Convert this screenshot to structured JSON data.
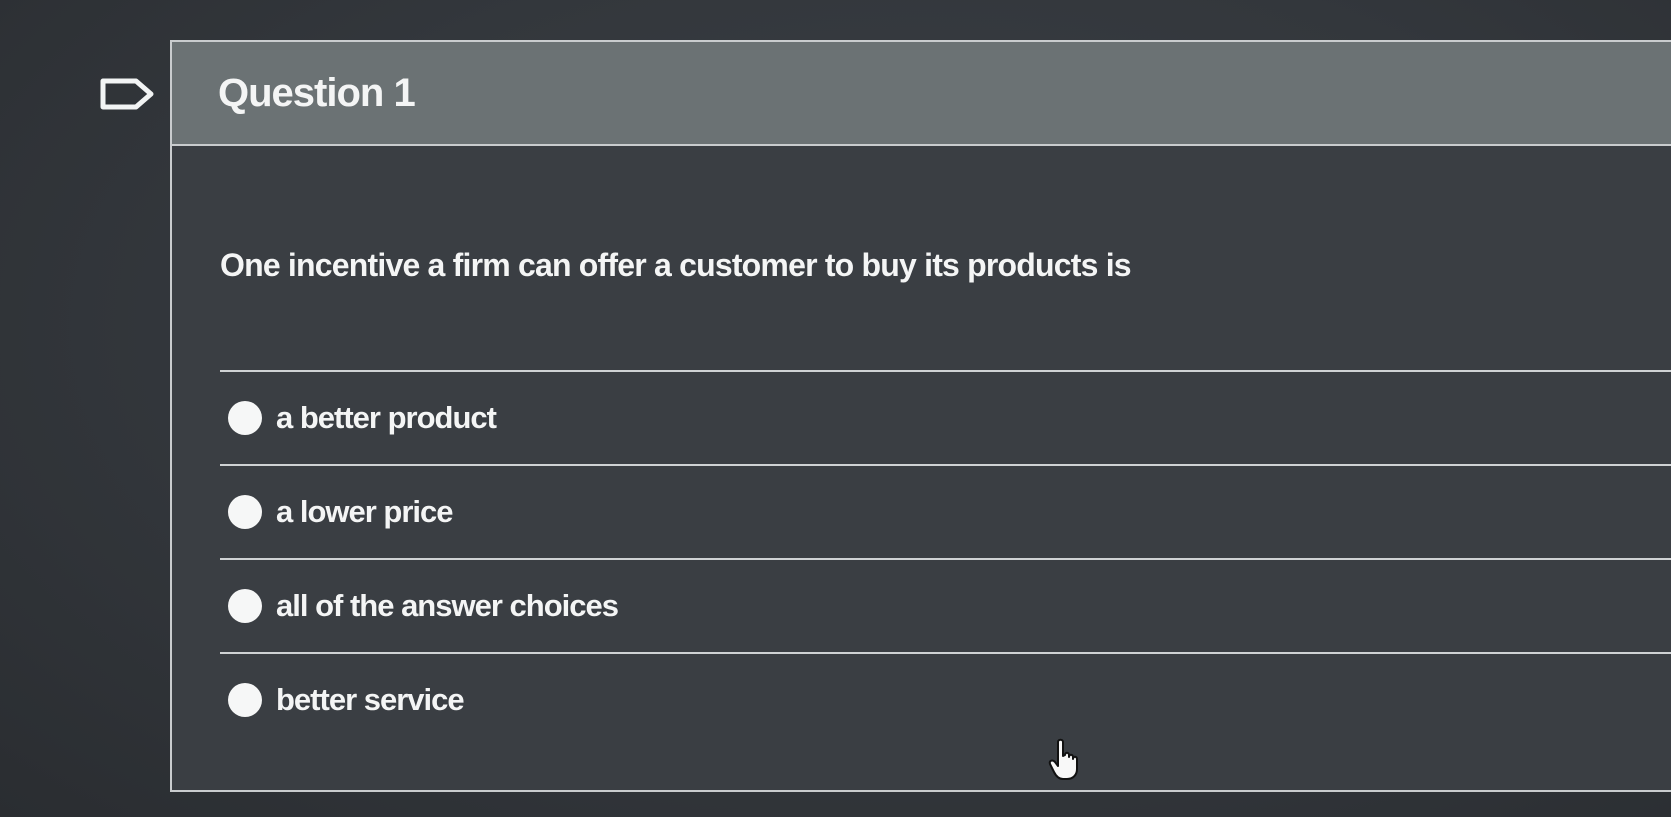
{
  "question": {
    "title": "Question 1",
    "prompt": "One incentive a firm can offer a customer to buy its products is",
    "flag_icon": "flag-icon",
    "answers": [
      {
        "label": "a better product"
      },
      {
        "label": "a lower price"
      },
      {
        "label": "all of the answer choices"
      },
      {
        "label": "better service"
      }
    ]
  },
  "pointer": {
    "icon": "hand-pointer-icon"
  }
}
